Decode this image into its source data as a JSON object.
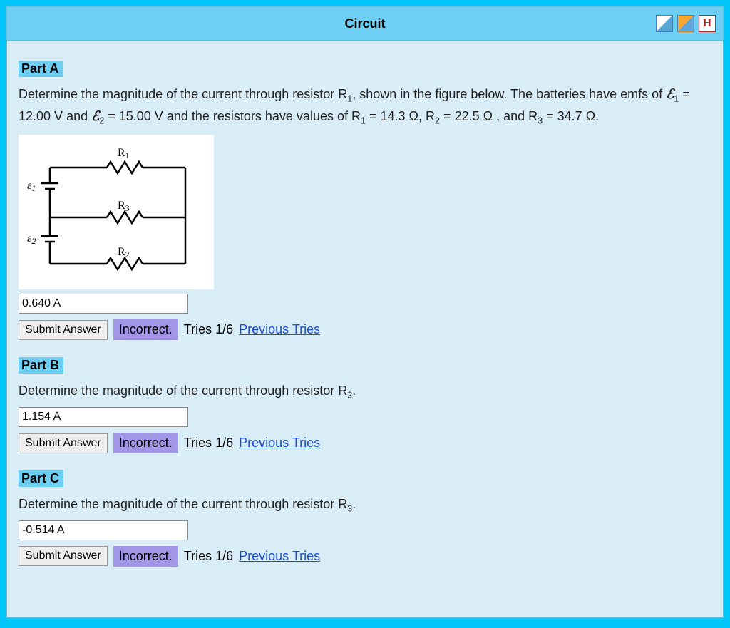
{
  "header": {
    "title": "Circuit",
    "icons": {
      "ruler": "",
      "book": "",
      "history": "H"
    }
  },
  "problem": {
    "emf1": "12.00 V",
    "emf2": "15.00 V",
    "r1": "14.3 Ω",
    "r2": "22.5 Ω",
    "r3": "34.7 Ω"
  },
  "diagram": {
    "r1_label": "R",
    "r2_label": "R",
    "r3_label": "R",
    "e1_label": "ε",
    "e2_label": "ε"
  },
  "parts": {
    "a": {
      "label": "Part A",
      "prompt_prefix": "Determine the magnitude of the current through resistor R",
      "prompt_target_sub": "1",
      "prompt_suffix": ", shown in the figure below. The batteries have emfs of ",
      "answer": "0.640 A",
      "submit": "Submit Answer",
      "status": "Incorrect.",
      "tries": "Tries 1/6",
      "prev": "Previous Tries"
    },
    "b": {
      "label": "Part B",
      "prompt": "Determine the magnitude of the current through resistor R",
      "prompt_sub": "2",
      "prompt_end": ".",
      "answer": "1.154 A",
      "submit": "Submit Answer",
      "status": "Incorrect.",
      "tries": "Tries 1/6",
      "prev": "Previous Tries"
    },
    "c": {
      "label": "Part C",
      "prompt": "Determine the magnitude of the current through resistor R",
      "prompt_sub": "3",
      "prompt_end": ".",
      "answer": "-0.514 A",
      "submit": "Submit Answer",
      "status": "Incorrect.",
      "tries": "Tries 1/6",
      "prev": "Previous Tries"
    }
  },
  "connectors": {
    "eq": " = ",
    "and": " and ",
    "resistors_intro": " and the resistors have values of R",
    "r1sub": "1",
    "comma_r2": ", R",
    "r2sub": "2",
    "comma_and_r3": ", and R",
    "r3sub": "3",
    "period": "."
  }
}
